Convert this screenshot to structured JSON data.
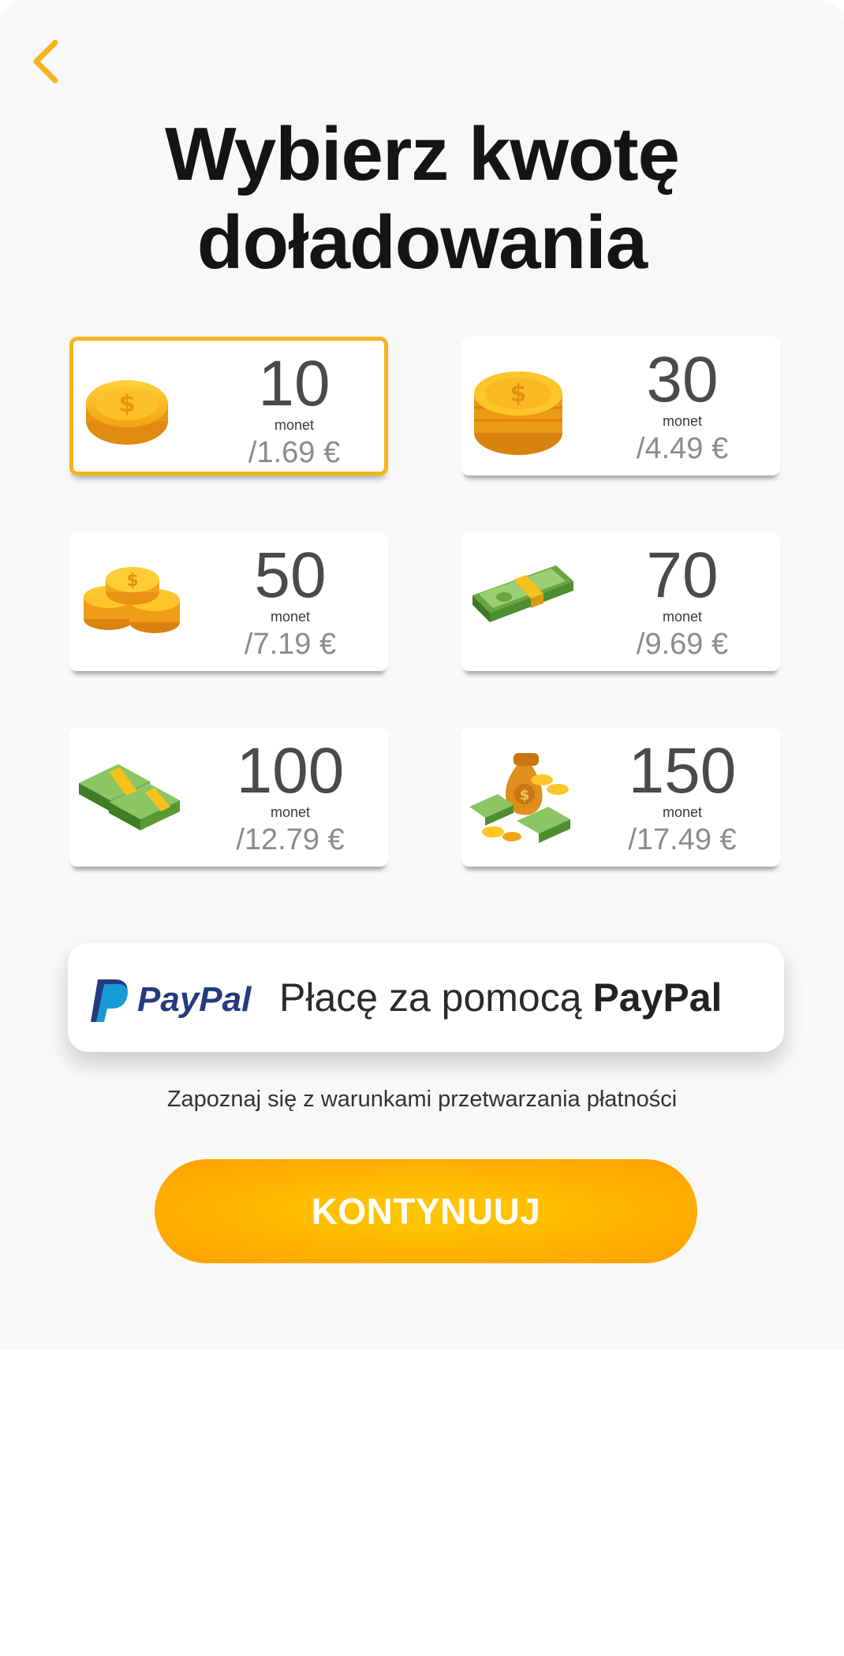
{
  "header": {
    "title": "Wybierz kwotę\ndoładowania",
    "back_icon": "chevron-left-icon",
    "accent": "#f5b51c"
  },
  "packages": [
    {
      "amount": "10",
      "unit": "monet",
      "price": "/1.69 €",
      "icon": "single-coin-icon",
      "selected": true
    },
    {
      "amount": "30",
      "unit": "monet",
      "price": "/4.49 €",
      "icon": "coin-stack-icon",
      "selected": false
    },
    {
      "amount": "50",
      "unit": "monet",
      "price": "/7.19 €",
      "icon": "coin-piles-icon",
      "selected": false
    },
    {
      "amount": "70",
      "unit": "monet",
      "price": "/9.69 €",
      "icon": "banknote-bundle-icon",
      "selected": false
    },
    {
      "amount": "100",
      "unit": "monet",
      "price": "/12.79 €",
      "icon": "banknote-stacks-icon",
      "selected": false
    },
    {
      "amount": "150",
      "unit": "monet",
      "price": "/17.49 €",
      "icon": "money-bag-icon",
      "selected": false
    }
  ],
  "payment": {
    "logo_text": "PayPal",
    "label_prefix": "Płacę za pomocą ",
    "label_brand": "PayPal"
  },
  "terms_link": "Zapoznaj się z warunkami przetwarzania płatności",
  "cta": {
    "label": "KONTYNUUJ",
    "color_from": "#ffc609",
    "color_to": "#ff9f00"
  }
}
